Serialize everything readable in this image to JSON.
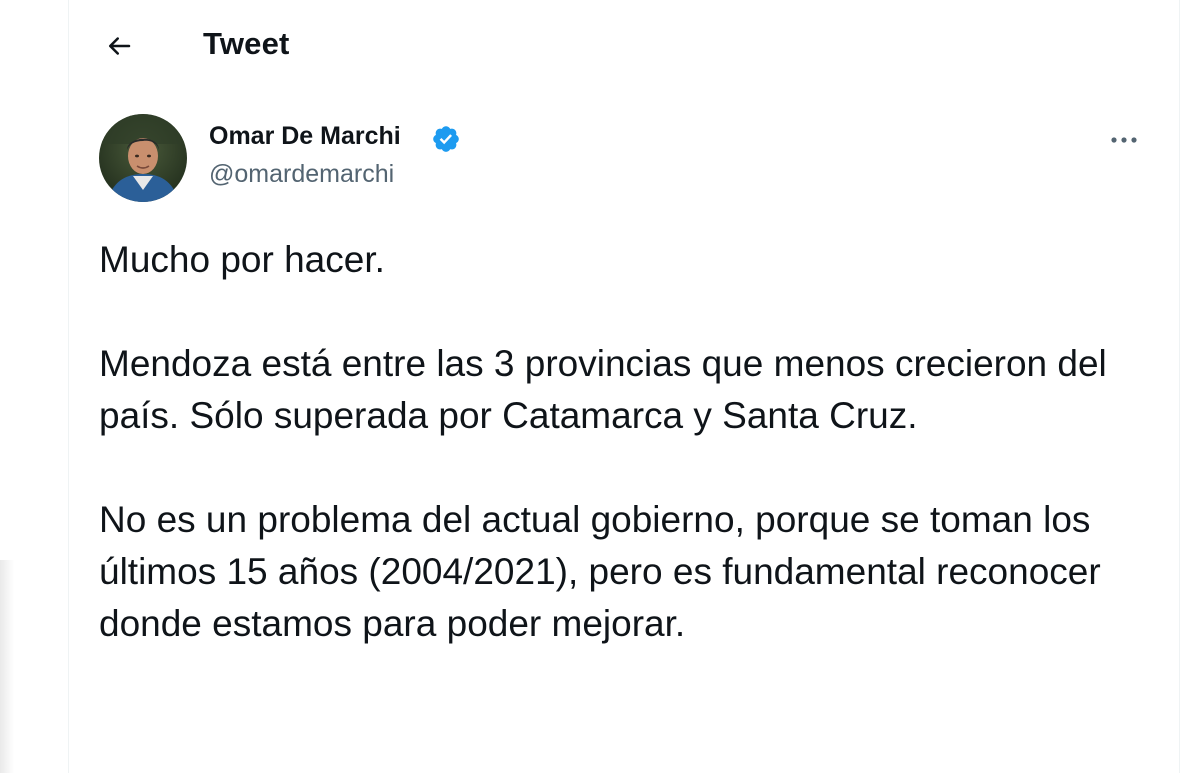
{
  "header": {
    "title": "Tweet",
    "back_icon": "arrow-left-icon"
  },
  "author": {
    "name": "Omar De Marchi",
    "handle": "@omardemarchi",
    "verified": true,
    "verified_color": "#1d9bf0",
    "avatar": "profile-photo"
  },
  "tweet": {
    "paragraphs": [
      "Mucho por hacer.",
      "Mendoza está entre las 3 provincias que menos crecieron del país. Sólo superada por Catamarca y Santa Cruz.",
      "No es un problema del actual gobierno, porque se toman los últimos 15 años (2004/2021), pero es fundamental reconocer donde estamos para poder mejorar."
    ]
  },
  "actions": {
    "more_icon": "more-horizontal-icon"
  },
  "colors": {
    "text": "#0f1419",
    "secondary_text": "#536471",
    "accent": "#1d9bf0",
    "border": "#eff3f4"
  }
}
